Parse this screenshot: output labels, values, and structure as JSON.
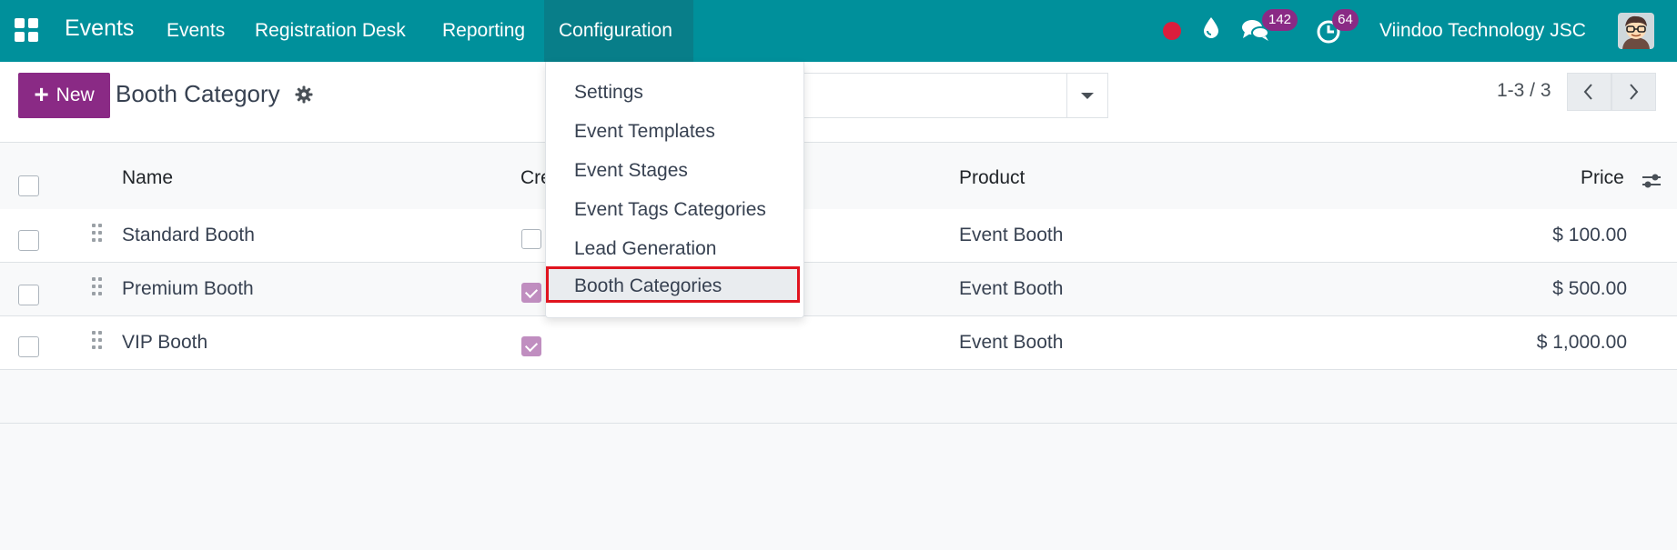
{
  "navbar": {
    "brand": "Events",
    "menu": [
      "Events",
      "Registration Desk",
      "Reporting",
      "Configuration"
    ],
    "chat_count": "142",
    "activity_count": "64",
    "company": "Viindoo Technology JSC",
    "bg_color": "#00909b"
  },
  "control_panel": {
    "new_label": "New",
    "title": "Booth Category",
    "pager": "1-3 / 3"
  },
  "dropdown": {
    "items": [
      "Settings",
      "Event Templates",
      "Event Stages",
      "Event Tags Categories",
      "Lead Generation",
      "Booth Categories"
    ],
    "highlighted": "Booth Categories"
  },
  "table": {
    "columns": [
      "Name",
      "Cre",
      "Product",
      "Price"
    ],
    "rows": [
      {
        "name": "Standard Booth",
        "created": false,
        "product": "Event Booth",
        "price": "$ 100.00"
      },
      {
        "name": "Premium Booth",
        "created": true,
        "product": "Event Booth",
        "price": "$ 500.00"
      },
      {
        "name": "VIP Booth",
        "created": true,
        "product": "Event Booth",
        "price": "$ 1,000.00"
      }
    ]
  },
  "colors": {
    "accent": "#8a2a85",
    "checkbox_checked": "#c08ec0",
    "highlight_border": "#e0141e"
  }
}
